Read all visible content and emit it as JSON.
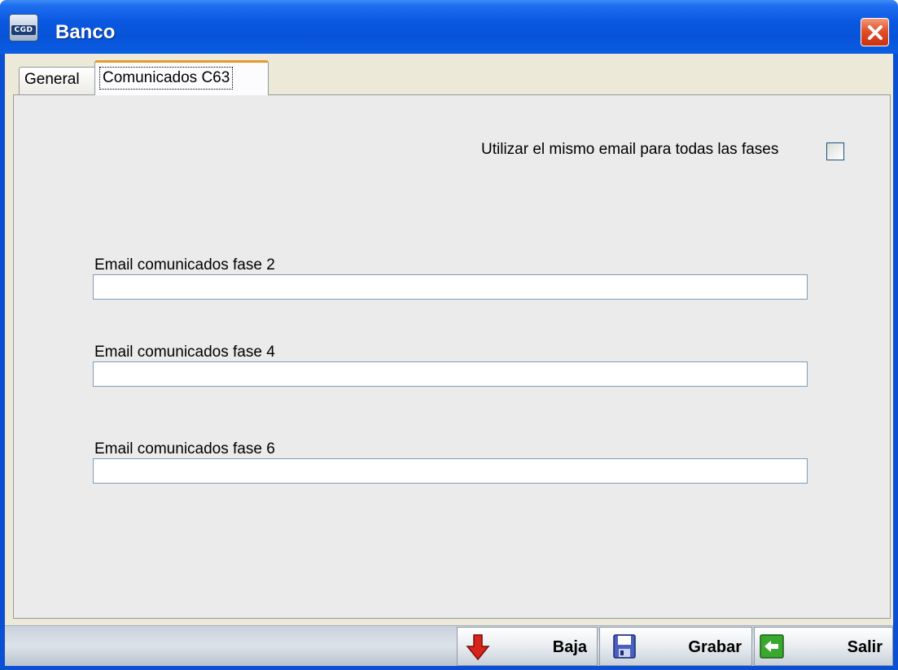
{
  "window": {
    "title": "Banco",
    "icon": "bank-app-icon",
    "icon_text": "CGD"
  },
  "tabs": [
    {
      "label": "General",
      "active": false
    },
    {
      "label": "Comunicados C63",
      "active": true
    }
  ],
  "options": {
    "same_email_label": "Utilizar el mismo email para todas las fases",
    "same_email_checked": false
  },
  "fields": [
    {
      "label": "Email comunicados fase 2",
      "value": ""
    },
    {
      "label": "Email comunicados fase 4",
      "value": ""
    },
    {
      "label": "Email comunicados fase 6",
      "value": ""
    }
  ],
  "buttons": {
    "baja": {
      "label": "Baja",
      "icon": "arrow-down-icon"
    },
    "grabar": {
      "label": "Grabar",
      "icon": "floppy-disk-icon"
    },
    "salir": {
      "label": "Salir",
      "icon": "exit-icon"
    }
  },
  "colors": {
    "titlebar": "#0a58e0",
    "active_tab_accent": "#e69a2c",
    "close_button": "#e2502a"
  }
}
